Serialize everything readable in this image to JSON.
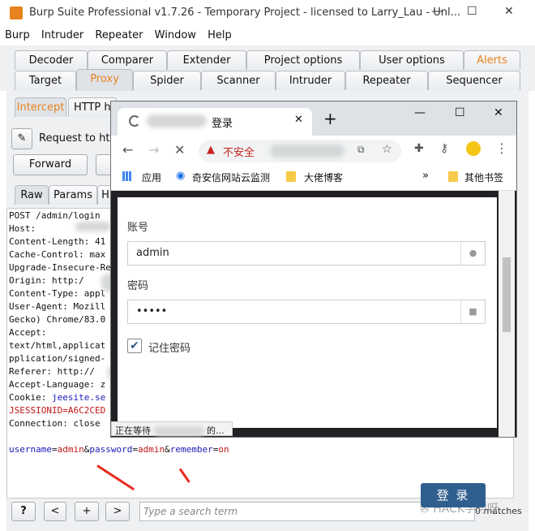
{
  "window": {
    "title": "Burp Suite Professional v1.7.26 - Temporary Project - licensed to Larry_Lau - Unl..."
  },
  "menu": [
    "Burp",
    "Intruder",
    "Repeater",
    "Window",
    "Help"
  ],
  "top_tabs_row1": [
    "Decoder",
    "Comparer",
    "Extender",
    "Project options",
    "User options",
    "Alerts"
  ],
  "top_tabs_row2": [
    "Target",
    "Proxy",
    "Spider",
    "Scanner",
    "Intruder",
    "Repeater",
    "Sequencer"
  ],
  "proxy_tabs": [
    "Intercept",
    "HTTP hi"
  ],
  "request_label": "Request to http",
  "forward_label": "Forward",
  "editor_tabs": [
    "Raw",
    "Params",
    "H"
  ],
  "request_lines": [
    "POST /admin/login",
    "Host:",
    "Content-Length: 41",
    "Cache-Control: max",
    "Upgrade-Insecure-Re",
    "Origin: http:/",
    "Content-Type: appl",
    "User-Agent: Mozill",
    "Gecko) Chrome/83.0",
    "Accept:",
    "text/html,applicat",
    "pplication/signed-",
    "Referer: http://",
    "Accept-Language: z",
    "Cookie: ",
    "JSESSIONID=A6C2CED",
    "Connection: close"
  ],
  "cookie_value": "jeesite.se",
  "body_line": {
    "k1": "username",
    "v1": "admin",
    "k2": "password",
    "v2": "admin",
    "k3": "remember",
    "v3": "on"
  },
  "bottom": {
    "help": "?",
    "prev": "<",
    "add": "+",
    "next": ">",
    "search_placeholder": "Type a search term",
    "matches": "0 matches"
  },
  "watermark": "HACK学习呀",
  "browser": {
    "tab_title": "登录",
    "insecure": "不安全",
    "bookmarks": [
      "应用",
      "奇安信网站云监测",
      "大佬博客",
      "»",
      "其他书签"
    ],
    "username_label": "账号",
    "username_value": "admin",
    "password_label": "密码",
    "password_value": "•••••",
    "remember_label": "记住密码",
    "login_button": "登 录",
    "status_text": "正在等待",
    "status_suffix": "的..."
  }
}
